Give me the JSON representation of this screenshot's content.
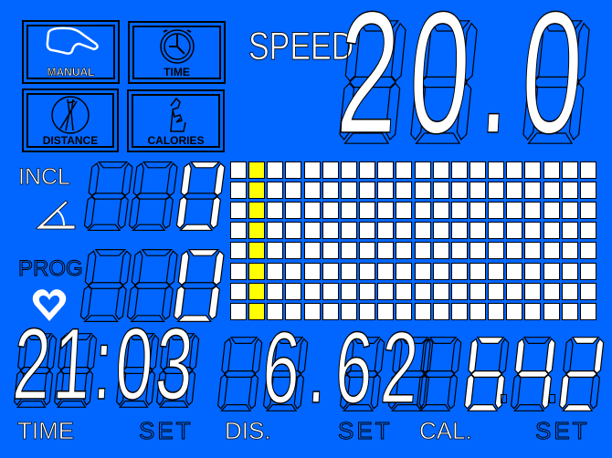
{
  "modes": [
    {
      "label": "MANUAL",
      "icon": "hand-icon",
      "active": true
    },
    {
      "label": "TIME",
      "icon": "clock-icon",
      "active": false
    },
    {
      "label": "DISTANCE",
      "icon": "runner-icon",
      "active": false
    },
    {
      "label": "CALORIES",
      "icon": "body-icon",
      "active": false
    }
  ],
  "speed": {
    "label": "SPEED",
    "value": "20.0"
  },
  "incline": {
    "label": "INCL",
    "icon": "incline-icon",
    "value": "0"
  },
  "program": {
    "label": "PROG",
    "icon": "heart-icon",
    "value": "0"
  },
  "matrix": {
    "columns": 20,
    "rows": 8,
    "active_column": 2,
    "active_color": "#ffff00",
    "cell_color": "#ffffff"
  },
  "bottom": {
    "time": {
      "label": "TIME",
      "value": "21:03",
      "set_label": "SET"
    },
    "distance": {
      "label": "DIS.",
      "value": "6.62",
      "set_label": "SET"
    },
    "calories": {
      "label": "CAL.",
      "value": "642",
      "set_label": "SET"
    }
  },
  "colors": {
    "background": "#0066ff",
    "segment_on": "#ffffff",
    "outline": "#000000"
  }
}
